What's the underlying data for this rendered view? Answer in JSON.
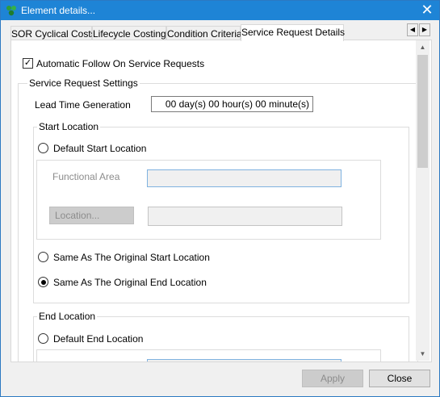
{
  "window": {
    "title": "Element details...",
    "close_glyph": "✕"
  },
  "tabs": [
    {
      "label": "SOR Cyclical Costs"
    },
    {
      "label": "Lifecycle Costing"
    },
    {
      "label": "Condition Criteria"
    },
    {
      "label": "Service Request Details",
      "active": true
    }
  ],
  "tab_scroll": {
    "left_glyph": "◀",
    "right_glyph": "▶"
  },
  "content": {
    "auto_follow": {
      "label": "Automatic Follow On Service Requests",
      "checked": true,
      "check_glyph": "✓"
    },
    "settings_group_title": "Service Request Settings",
    "lead_time": {
      "label": "Lead Time Generation",
      "value": "00 day(s) 00 hour(s) 00 minute(s)"
    },
    "start_location": {
      "title": "Start Location",
      "default_option": "Default Start Location",
      "functional_area_label": "Functional Area",
      "functional_area_value": "",
      "location_button": "Location...",
      "location_value": "",
      "same_as_start": "Same As The Original Start Location",
      "same_as_end": "Same As The Original End Location",
      "selected": "same_as_end"
    },
    "end_location": {
      "title": "End Location",
      "default_option": "Default End Location"
    }
  },
  "scrollbar": {
    "up_glyph": "▲",
    "down_glyph": "▼"
  },
  "footer": {
    "apply_label": "Apply",
    "close_label": "Close"
  },
  "colors": {
    "titlebar": "#1e84d6",
    "border": "#2b79c2",
    "dialog_bg": "#f0f0f0"
  }
}
